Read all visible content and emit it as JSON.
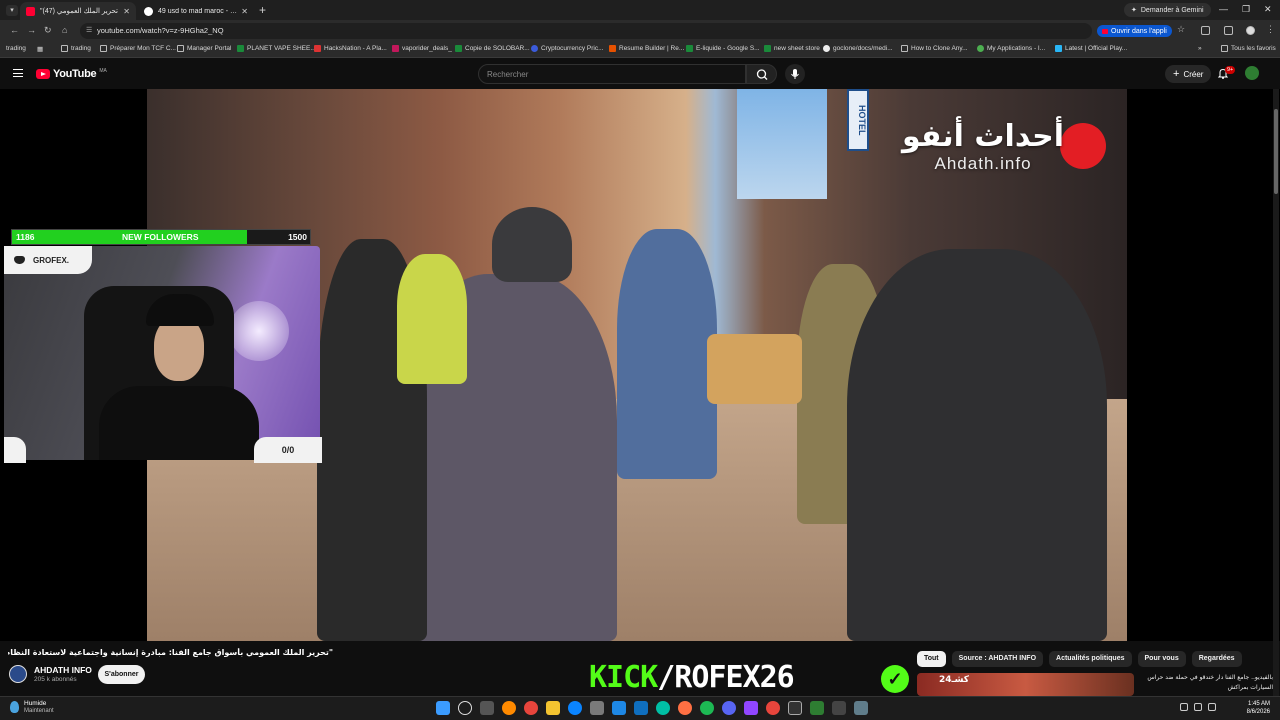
{
  "browser": {
    "tabs": [
      {
        "title": "\"تحرير الملك العمومي (47)",
        "active": true
      },
      {
        "title": "49 usd to mad maroc - Recherch",
        "active": false
      }
    ],
    "gemini_label": "Demander à Gemini",
    "url": "youtube.com/watch?v=z-9HGha2_NQ",
    "open_app_label": "Ouvrir dans l'appli",
    "bookmarks": [
      "trading",
      "trading",
      "Préparer Mon TCF C...",
      "Manager Portal",
      "PLANET VAPE SHEE...",
      "HacksNation - A Pla...",
      "vaporider_deals_",
      "Copie de SOLOBAR...",
      "Cryptocurrency Pric...",
      "Resume Builder | Re...",
      "E-liquide - Google S...",
      "new sheet store",
      "goclone/docs/medi...",
      "How to Clone Any...",
      "My Applications - I...",
      "Latest | Official Play..."
    ],
    "bookmarks_all": "Tous les favoris"
  },
  "youtube": {
    "logo_text": "YouTube",
    "country_code": "MA",
    "search_placeholder": "Rechercher",
    "create_label": "Créer",
    "notif_count": "9+"
  },
  "video": {
    "watermark_ar": "أحداث أنفو",
    "watermark_en": "Ahdath.info",
    "hotel_sign": "HOTEL",
    "title": "\"تحرير الملك العمومي بأسواق جامع الفنا: مبادرة إنسانية واجتماعية لاستعادة النظام وحماية الحقوق\"",
    "channel_name": "AHDATH INFO",
    "subscribers": "205 k abonnés",
    "subscribe_label": "S'abonner"
  },
  "overlay": {
    "followers_current": "1186",
    "followers_label": "NEW FOLLOWERS",
    "followers_goal": "1500",
    "followers_progress": 0.79,
    "discord_name": "GROFEX.",
    "counter": "0/0",
    "kick_prefix": "KICK",
    "kick_handle": "/ROFEX26"
  },
  "sidebar": {
    "chips": [
      "Tout",
      "Source : AHDATH INFO",
      "Actualités politiques",
      "Pour vous",
      "Regardées"
    ],
    "selected_chip": 0,
    "rec_thumb_text": "كشـ24",
    "rec_title": "بالفيديو.. جامع الفنا دار خندقو في حملة ضد حراس السيارات بمراكش"
  },
  "taskbar": {
    "weather_title": "Humide",
    "weather_sub": "Maintenant",
    "time": "1:45 AM",
    "date": "8/6/2026"
  },
  "colors": {
    "kick_green": "#53fc18",
    "youtube_red": "#ff0033",
    "follow_bar": "#22d01f"
  }
}
